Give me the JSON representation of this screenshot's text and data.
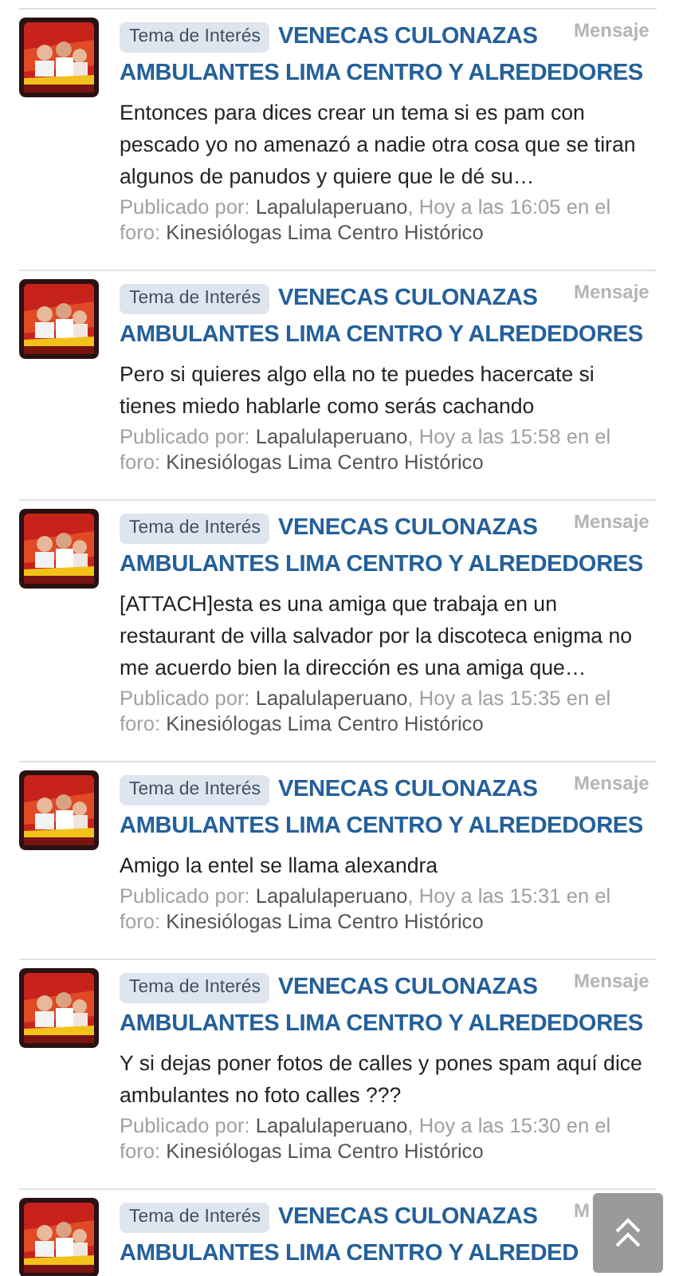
{
  "posts": [
    {
      "badge": "Tema de Interés",
      "title": [
        "VENECAS CULONAZAS",
        "AMBULANTES LIMA CENTRO Y ALREDEDORES"
      ],
      "type_label": "Mensaje",
      "excerpt": "Entonces para dices crear un tema si es pam con pescado yo no amenazó a nadie otra cosa que se tiran algunos de panudos y quiere que le dé su…",
      "meta_label": "Publicado por:",
      "author": "Lapalulaperuano",
      "after_author": ", Hoy a las 16:05 en el foro:",
      "forum": "Kinesiólogas Lima Centro Histórico"
    },
    {
      "badge": "Tema de Interés",
      "title": [
        "VENECAS CULONAZAS",
        "AMBULANTES LIMA CENTRO Y ALREDEDORES"
      ],
      "type_label": "Mensaje",
      "excerpt": "Pero si quieres algo ella no te puedes hacercate si tienes miedo hablarle como serás cachando",
      "meta_label": "Publicado por:",
      "author": "Lapalulaperuano",
      "after_author": ", Hoy a las 15:58 en el foro:",
      "forum": "Kinesiólogas Lima Centro Histórico"
    },
    {
      "badge": "Tema de Interés",
      "title": [
        "VENECAS CULONAZAS",
        "AMBULANTES LIMA CENTRO Y ALREDEDORES"
      ],
      "type_label": "Mensaje",
      "excerpt": "[ATTACH]esta es una amiga que trabaja en un restaurant de villa salvador por la discoteca enigma no me acuerdo bien la dirección es una amiga que…",
      "meta_label": "Publicado por:",
      "author": "Lapalulaperuano",
      "after_author": ", Hoy a las 15:35 en el foro:",
      "forum": "Kinesiólogas Lima Centro Histórico"
    },
    {
      "badge": "Tema de Interés",
      "title": [
        "VENECAS CULONAZAS",
        "AMBULANTES LIMA CENTRO Y ALREDEDORES"
      ],
      "type_label": "Mensaje",
      "excerpt": "Amigo la entel se llama alexandra",
      "meta_label": "Publicado por:",
      "author": "Lapalulaperuano",
      "after_author": ", Hoy a las 15:31 en el foro:",
      "forum": "Kinesiólogas Lima Centro Histórico"
    },
    {
      "badge": "Tema de Interés",
      "title": [
        "VENECAS CULONAZAS",
        "AMBULANTES LIMA CENTRO Y ALREDEDORES"
      ],
      "type_label": "Mensaje",
      "excerpt": "Y si dejas poner fotos de calles y pones spam aquí dice ambulantes no foto calles ???",
      "meta_label": "Publicado por:",
      "author": "Lapalulaperuano",
      "after_author": ", Hoy a las 15:30 en el foro:",
      "forum": "Kinesiólogas Lima Centro Histórico"
    },
    {
      "badge": "Tema de Interés",
      "title": [
        "VENECAS CULONAZAS",
        "AMBULANTES LIMA CENTRO Y ALREDED"
      ],
      "type_label": "M"
    }
  ]
}
